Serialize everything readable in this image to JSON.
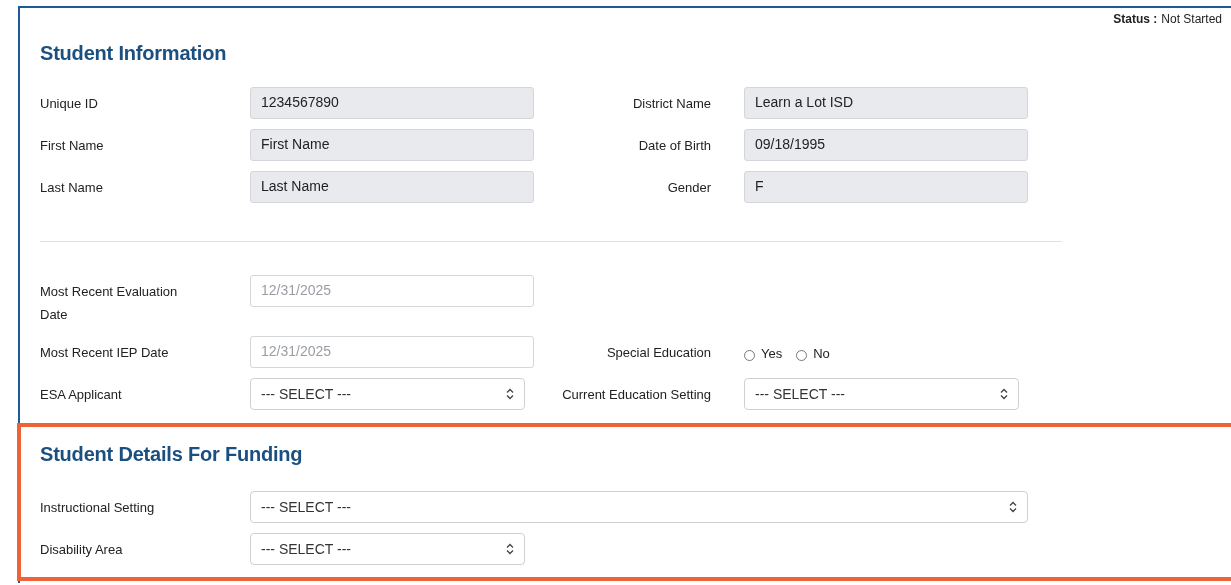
{
  "status": {
    "label": "Status :",
    "value": "Not Started"
  },
  "sections": [
    {
      "title": "Student Information",
      "highlighted": false,
      "groups": [
        [
          [
            {
              "label": "Unique ID",
              "kind": "text",
              "readonly": true,
              "value": "1234567890"
            },
            {
              "label": "District Name",
              "kind": "text",
              "readonly": true,
              "value": "Learn a Lot ISD"
            }
          ],
          [
            {
              "label": "First Name",
              "kind": "text",
              "readonly": true,
              "value": "First Name"
            },
            {
              "label": "Date of Birth",
              "kind": "text",
              "readonly": true,
              "value": "09/18/1995"
            }
          ],
          [
            {
              "label": "Last Name",
              "kind": "text",
              "readonly": true,
              "value": "Last Name"
            },
            {
              "label": "Gender",
              "kind": "text",
              "readonly": true,
              "value": "F"
            }
          ]
        ],
        [
          [
            {
              "label": "Most Recent Evaluation Date",
              "kind": "date",
              "readonly": false,
              "placeholder": "12/31/2025"
            }
          ],
          [
            {
              "label": "Most Recent IEP Date",
              "kind": "date",
              "readonly": false,
              "placeholder": "12/31/2025"
            },
            {
              "label": "Special Education",
              "kind": "radio",
              "options": [
                {
                  "label": "Yes",
                  "selected": false
                },
                {
                  "label": "No",
                  "selected": false
                }
              ]
            }
          ],
          [
            {
              "label": "ESA Applicant",
              "kind": "select",
              "value": "--- SELECT ---"
            },
            {
              "label": "Current Education Setting",
              "kind": "select",
              "value": "--- SELECT ---"
            }
          ]
        ]
      ]
    },
    {
      "title": "Student Details For Funding",
      "highlighted": true,
      "groups": [
        [
          [
            {
              "label": "Instructional Setting",
              "kind": "select",
              "wide": true,
              "value": "--- SELECT ---"
            }
          ],
          [
            {
              "label": "Disability Area",
              "kind": "select",
              "value": "--- SELECT ---"
            }
          ]
        ]
      ]
    }
  ]
}
